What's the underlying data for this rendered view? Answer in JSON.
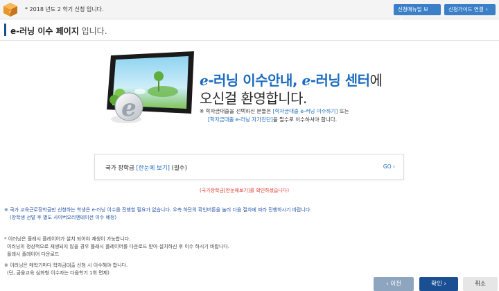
{
  "topbar": {
    "notice": "* 2018 년도 2 학기 신청 입니다.",
    "manual_button": "신청매뉴얼 보기",
    "guide_button": "신청가이드 연결",
    "chevron": "›"
  },
  "page": {
    "title_strong": "e-러닝 이수 페이지",
    "title_rest": " 입니다."
  },
  "hero": {
    "line1_e1": "e",
    "line1_part1": "-러닝 이수안내, ",
    "line1_e2": "e",
    "line1_part2": "-러닝 센터",
    "line1_part3": "에",
    "line2": "오신걸 환영합니다.",
    "note1_pre": "※ 학자금대출을 선택하신 분들은 ",
    "note1_link": "[학자금대출 e-러닝 이수하기]",
    "note1_post": " 또는",
    "note2_link": "[학자금대출 e-러닝 자가진단]",
    "note2_post": "을 필수로 이수하셔야 합니다."
  },
  "card": {
    "title_pre": "국가 장학금 ",
    "title_link": "[한눈에 보기]",
    "title_post": " (필수)",
    "go": "GO ›"
  },
  "warning": "(국가장학금[한눈에보기]를 확인하셨습니다)",
  "info": {
    "blue1": "※ 국가 교육근로장학금만 신청하는 학생은 e-러닝 이수를 진행할 필요가 없습니다. 우측 하단의 확인버튼을 눌러 다음 절차에 따라 진행하시기 바랍니다.",
    "blue2": "(장학생 선발 후 별도 사이버오리엔테이션 이수 예정)",
    "grey1": "* 이러닝은 플래시 플레이어가 설치 되어야 재생이 가능합니다.",
    "grey2": "이러닝이 정상적으로 재생되지 않을 경우 플래시 플레이어를 다운로드 받아 설치하신 후 이수 하시기 바랍니다.",
    "grey3": "플래시 플레이어 다운로드",
    "grey4": "※ 이러닝은 매학기마다 학자금대출 신청 시 이수해야 합니다.",
    "grey5": "(단, 금융교육 심화형 이수자는 다음학기 1회 면제)"
  },
  "buttons": {
    "prev": "‹ 이전",
    "ok": "확인 ›",
    "cancel": "취소"
  },
  "colors": {
    "accent": "#1b6bc0",
    "primary_button": "#1b4f93",
    "secondary_button": "#8ea5bf",
    "warning": "#e0392a",
    "info_blue": "#2453a8"
  },
  "icons": {
    "logo": "box-logo-icon",
    "hero": "tablet-e-learning-illustration"
  }
}
